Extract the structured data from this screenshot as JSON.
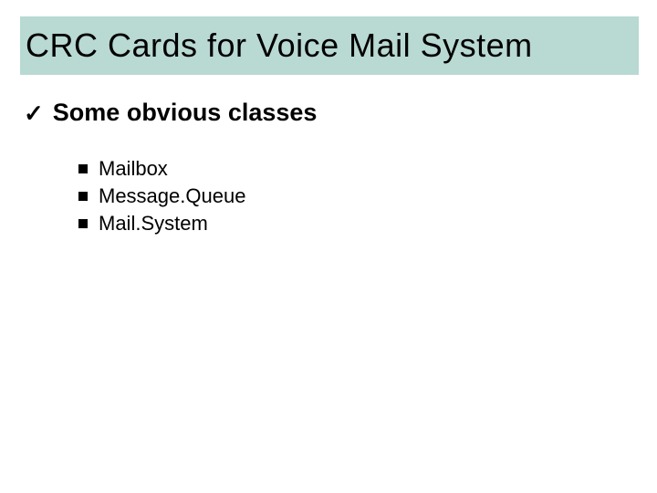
{
  "title": "CRC Cards for Voice Mail System",
  "bullet1": "Some obvious classes",
  "sublist": {
    "item0": "Mailbox",
    "item1": "Message.Queue",
    "item2": "Mail.System"
  }
}
